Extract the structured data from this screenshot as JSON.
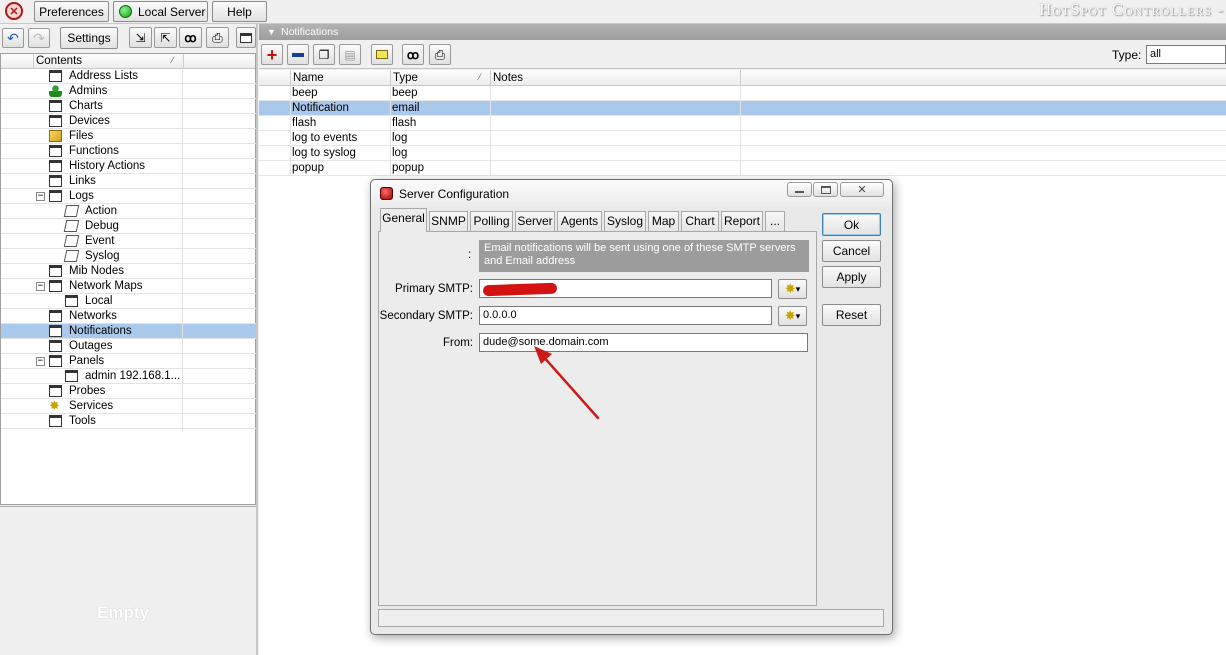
{
  "top_bar": {
    "preferences_label": "Preferences",
    "server_label": "Local Server",
    "help_label": "Help",
    "app_title": "HotSpot Controllers -"
  },
  "toolbar": {
    "settings_label": "Settings"
  },
  "contents": {
    "header": "Contents",
    "items": [
      {
        "label": "Address Lists",
        "icon": "window-icon",
        "level": 1
      },
      {
        "label": "Admins",
        "icon": "admin-icon",
        "level": 1
      },
      {
        "label": "Charts",
        "icon": "window-icon",
        "level": 1
      },
      {
        "label": "Devices",
        "icon": "window-icon",
        "level": 1
      },
      {
        "label": "Files",
        "icon": "files-icon",
        "level": 1
      },
      {
        "label": "Functions",
        "icon": "window-icon",
        "level": 1
      },
      {
        "label": "History Actions",
        "icon": "window-icon",
        "level": 1
      },
      {
        "label": "Links",
        "icon": "window-icon",
        "level": 1
      },
      {
        "label": "Logs",
        "icon": "window-icon",
        "level": 1,
        "expander": "−"
      },
      {
        "label": "Action",
        "icon": "log-icon",
        "level": 2
      },
      {
        "label": "Debug",
        "icon": "log-icon",
        "level": 2
      },
      {
        "label": "Event",
        "icon": "log-icon",
        "level": 2
      },
      {
        "label": "Syslog",
        "icon": "log-icon",
        "level": 2
      },
      {
        "label": "Mib Nodes",
        "icon": "window-icon",
        "level": 1
      },
      {
        "label": "Network Maps",
        "icon": "window-icon",
        "level": 1,
        "expander": "−"
      },
      {
        "label": "Local",
        "icon": "window-icon",
        "level": 2
      },
      {
        "label": "Networks",
        "icon": "window-icon",
        "level": 1
      },
      {
        "label": "Notifications",
        "icon": "window-icon",
        "level": 1,
        "selected": true
      },
      {
        "label": "Outages",
        "icon": "window-icon",
        "level": 1
      },
      {
        "label": "Panels",
        "icon": "window-icon",
        "level": 1,
        "expander": "−"
      },
      {
        "label": "admin 192.168.1...",
        "icon": "window-icon",
        "level": 2
      },
      {
        "label": "Probes",
        "icon": "window-icon",
        "level": 1
      },
      {
        "label": "Services",
        "icon": "gear-icon",
        "level": 1
      },
      {
        "label": "Tools",
        "icon": "window-icon",
        "level": 1
      }
    ],
    "empty_label": "Empty"
  },
  "notifications": {
    "title": "Notifications",
    "type_label": "Type:",
    "type_value": "all",
    "columns": [
      "Name",
      "Type",
      "Notes"
    ],
    "rows": [
      {
        "name": "beep",
        "type": "beep",
        "notes": ""
      },
      {
        "name": "Notification",
        "type": "email",
        "notes": "",
        "selected": true
      },
      {
        "name": "flash",
        "type": "flash",
        "notes": ""
      },
      {
        "name": "log to events",
        "type": "log",
        "notes": ""
      },
      {
        "name": "log to syslog",
        "type": "log",
        "notes": ""
      },
      {
        "name": "popup",
        "type": "popup",
        "notes": ""
      }
    ]
  },
  "dialog": {
    "title": "Server Configuration",
    "tabs": [
      "General",
      "SNMP",
      "Polling",
      "Server",
      "Agents",
      "Syslog",
      "Map",
      "Chart",
      "Report",
      "..."
    ],
    "active_tab": "General",
    "info_colon": ":",
    "info_text": "Email notifications will be sent using one of these SMTP servers and Email address",
    "primary_smtp_label": "Primary SMTP:",
    "primary_smtp_value": "",
    "secondary_smtp_label": "Secondary SMTP:",
    "secondary_smtp_value": "0.0.0.0",
    "from_label": "From:",
    "from_value": "dude@some.domain.com",
    "ok_label": "Ok",
    "cancel_label": "Cancel",
    "apply_label": "Apply",
    "reset_label": "Reset"
  },
  "colors": {
    "selection": "#a8c8ec",
    "info_box": "#9c9c9c",
    "notif_header": "#a7a7a7",
    "arrow": "#cc1a1a"
  }
}
